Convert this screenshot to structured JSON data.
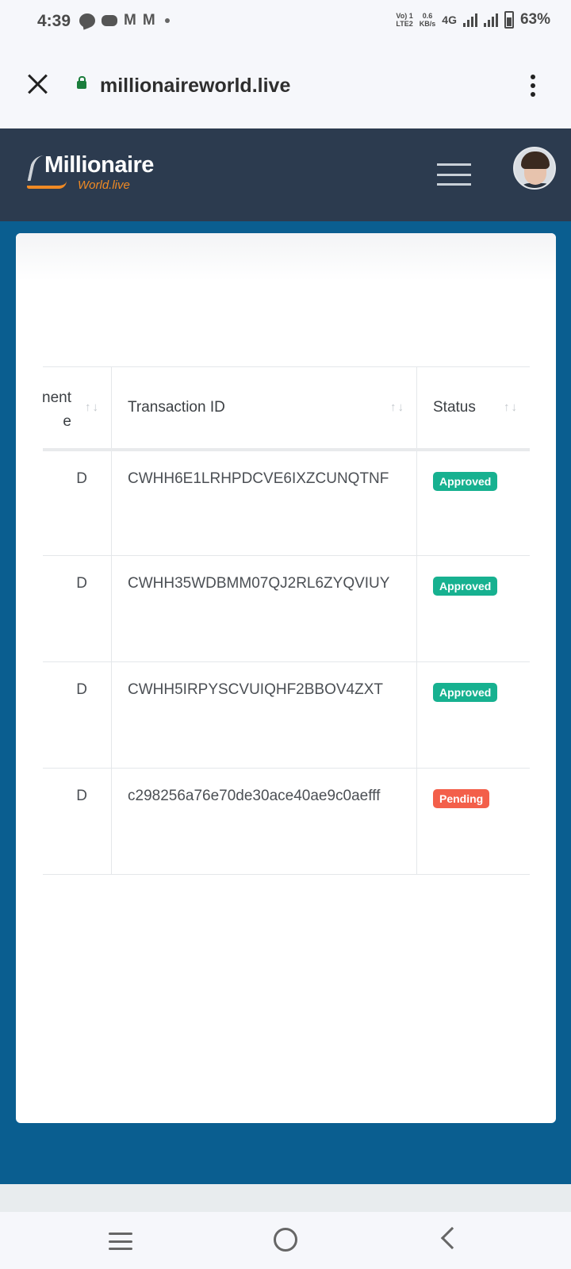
{
  "status_bar": {
    "time": "4:39",
    "volte": "Vo) 1\nLTE2",
    "net_speed_value": "0.6",
    "net_speed_unit": "KB/s",
    "network": "4G",
    "battery": "63%"
  },
  "browser": {
    "url": "millionaireworld.live"
  },
  "site": {
    "logo_main": "Millionaire",
    "logo_sub": "World.live"
  },
  "table": {
    "headers": {
      "col1_line1": "nent",
      "col1_line2": "e",
      "transaction_id": "Transaction ID",
      "status": "Status",
      "sort_glyph": "↑↓"
    },
    "rows": [
      {
        "col1": "D",
        "transaction_id": "CWHH6E1LRHPDCVE6IXZCUNQTNF",
        "status": "Approved"
      },
      {
        "col1": "D",
        "transaction_id": "CWHH35WDBMM07QJ2RL6ZYQVIUY",
        "status": "Approved"
      },
      {
        "col1": "D",
        "transaction_id": "CWHH5IRPYSCVUIQHF2BBOV4ZXT",
        "status": "Approved"
      },
      {
        "col1": "D",
        "transaction_id": "c298256a76e70de30ace40ae9c0aefff",
        "status": "Pending"
      }
    ]
  },
  "colors": {
    "header_bg": "#2c3b4f",
    "page_bg": "#0a5e90",
    "approved": "#17b190",
    "pending": "#f35f4a",
    "logo_accent": "#f08a24"
  }
}
